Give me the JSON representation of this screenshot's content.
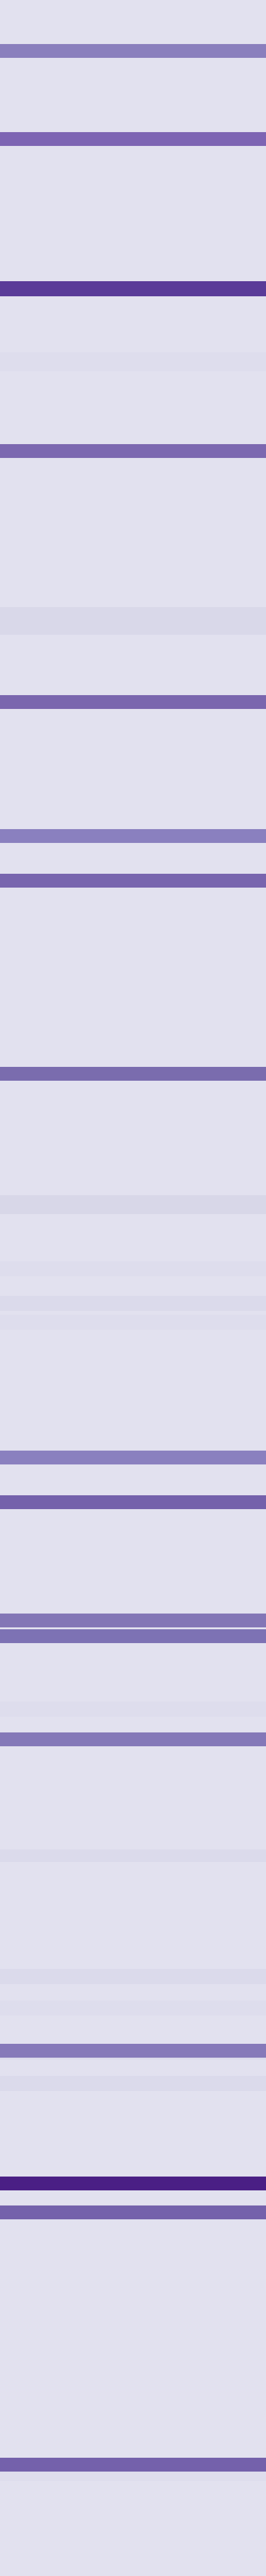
{
  "page": {
    "background": "#e2e1ef"
  },
  "bands": [
    {
      "kind": "stripe",
      "color": "#8a7fbd"
    },
    {
      "kind": "stripe",
      "color": "#7d64b3"
    },
    {
      "kind": "stripe",
      "color": "#5a3b98"
    },
    {
      "kind": "stripe",
      "color": "#7c68b0"
    },
    {
      "kind": "stripe",
      "color": "#7a66ae"
    },
    {
      "kind": "stripe",
      "color": "#8a80bf"
    },
    {
      "kind": "stripe",
      "color": "#7865ae"
    },
    {
      "kind": "stripe",
      "color": "#7a6cae"
    },
    {
      "kind": "stripe",
      "color": "#8a80bf"
    },
    {
      "kind": "stripe",
      "color": "#7461ab"
    },
    {
      "kind": "stripe",
      "color": "#8376b6"
    },
    {
      "kind": "stripe",
      "color": "#7d72b4"
    },
    {
      "kind": "stripe",
      "color": "#8478b8"
    },
    {
      "kind": "stripe",
      "color": "#8679b9"
    },
    {
      "kind": "stripe",
      "color": "#4a1f85"
    },
    {
      "kind": "stripe",
      "color": "#7461ab"
    },
    {
      "kind": "stripe",
      "color": "#7461ab"
    },
    {
      "kind": "shade",
      "color": "#dedded"
    },
    {
      "kind": "shade",
      "color": "#d9d8e9"
    },
    {
      "kind": "shade",
      "color": "#d8d7e8"
    },
    {
      "kind": "shade",
      "color": "#dedded"
    },
    {
      "kind": "shade",
      "color": "#dbdaeb"
    },
    {
      "kind": "shade",
      "color": "#dedded"
    },
    {
      "kind": "shade",
      "color": "#dedded"
    },
    {
      "kind": "shade",
      "color": "#dbdaeb"
    },
    {
      "kind": "shade",
      "color": "#dbdaeb"
    },
    {
      "kind": "shade",
      "color": "#dedded"
    },
    {
      "kind": "shade",
      "color": "#dbdaeb"
    },
    {
      "kind": "shade",
      "color": "#dbdaeb"
    },
    {
      "kind": "shade",
      "color": "#dedded"
    }
  ]
}
